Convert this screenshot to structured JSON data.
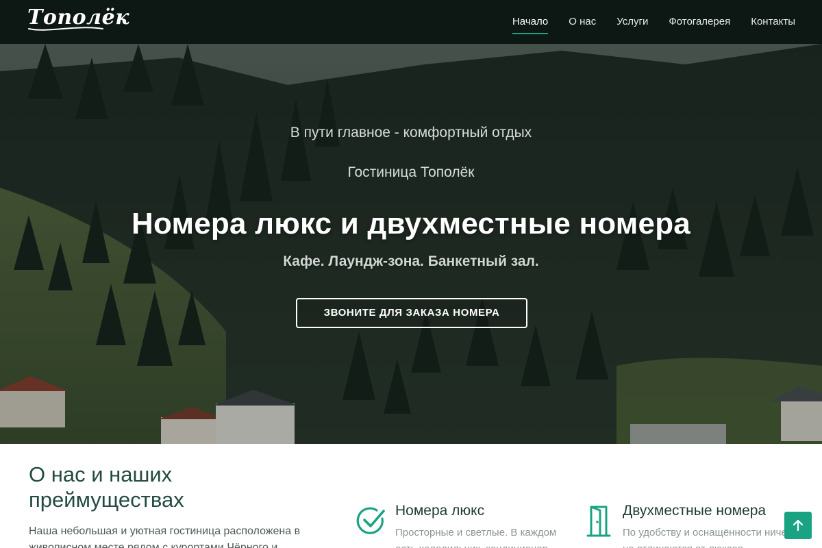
{
  "brand": {
    "logo_text": "Тополёк"
  },
  "nav": {
    "items": [
      {
        "label": "Начало",
        "active": true
      },
      {
        "label": "О нас",
        "active": false
      },
      {
        "label": "Услуги",
        "active": false
      },
      {
        "label": "Фотогалерея",
        "active": false
      },
      {
        "label": "Контакты",
        "active": false
      }
    ]
  },
  "hero": {
    "subtitle1": "В пути главное - комфортный отдых",
    "subtitle2": "Гостиница Тополёк",
    "title": "Номера люкс и двухместные номера",
    "features": "Кафе. Лаундж-зона. Банкетный зал.",
    "cta_label": "ЗВОНИТЕ ДЛЯ ЗАКАЗА НОМЕРА"
  },
  "about": {
    "title": "О нас и наших преймуществах",
    "text": "Наша небольшая и уютная гостиница расположена в живописном месте рядом с курортами Чёрного и"
  },
  "features": [
    {
      "icon": "check-circle-icon",
      "title": "Номера люкс",
      "text": "Просторные и светлые. В каждом есть холодильник, кондиционер"
    },
    {
      "icon": "door-icon",
      "title": "Двухместные номера",
      "text": "По удобству и оснащённости ничем не отличаются от люксов"
    }
  ],
  "colors": {
    "accent": "#1aa383",
    "navbar": "#0d1714",
    "heading": "#244a41"
  },
  "scroll_top": {
    "icon": "arrow-up-icon"
  }
}
